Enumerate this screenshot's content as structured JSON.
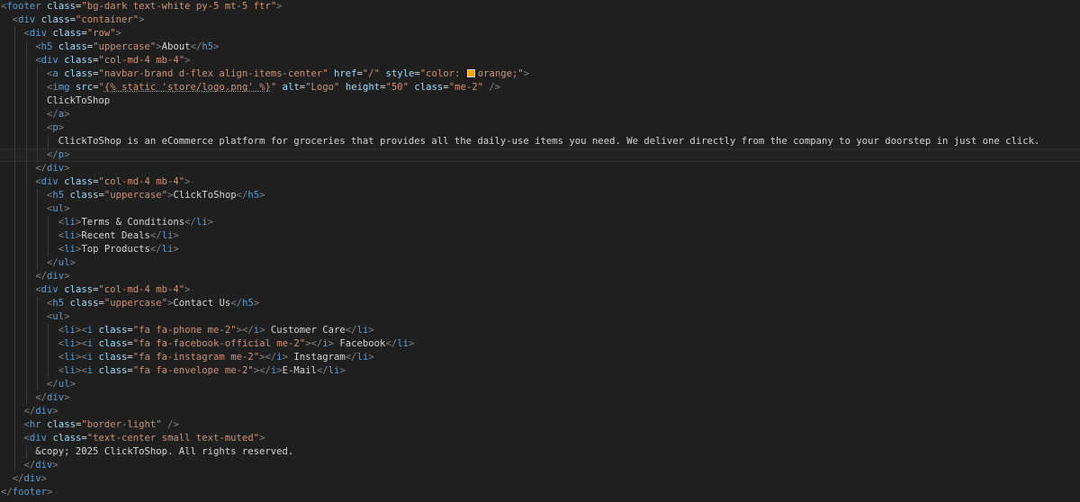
{
  "editor": {
    "language": "html",
    "theme_colors": {
      "background": "#1f1f1f",
      "bracket": "#808080",
      "tag": "#569cd6",
      "attribute": "#9cdcfe",
      "string": "#ce9178",
      "text": "#d4d4d4",
      "swatch": "#ffa500"
    },
    "lines": [
      {
        "indent": 0,
        "tokens": [
          [
            "br",
            "<"
          ],
          [
            "tag",
            "footer"
          ],
          [
            "sp",
            " "
          ],
          [
            "attr",
            "class"
          ],
          [
            "eq",
            "="
          ],
          [
            "str",
            "\"bg-dark text-white py-5 mt-5 ftr\""
          ],
          [
            "br",
            ">"
          ]
        ]
      },
      {
        "indent": 1,
        "tokens": [
          [
            "br",
            "<"
          ],
          [
            "tag",
            "div"
          ],
          [
            "sp",
            " "
          ],
          [
            "attr",
            "class"
          ],
          [
            "eq",
            "="
          ],
          [
            "str",
            "\"container\""
          ],
          [
            "br",
            ">"
          ]
        ]
      },
      {
        "indent": 2,
        "tokens": [
          [
            "br",
            "<"
          ],
          [
            "tag",
            "div"
          ],
          [
            "sp",
            " "
          ],
          [
            "attr",
            "class"
          ],
          [
            "eq",
            "="
          ],
          [
            "str",
            "\"row\""
          ],
          [
            "br",
            ">"
          ]
        ]
      },
      {
        "indent": 3,
        "tokens": [
          [
            "br",
            "<"
          ],
          [
            "tag",
            "h5"
          ],
          [
            "sp",
            " "
          ],
          [
            "attr",
            "class"
          ],
          [
            "eq",
            "="
          ],
          [
            "str",
            "\"uppercase\""
          ],
          [
            "br",
            ">"
          ],
          [
            "txt",
            "About"
          ],
          [
            "br",
            "</"
          ],
          [
            "tag",
            "h5"
          ],
          [
            "br",
            ">"
          ]
        ]
      },
      {
        "indent": 3,
        "tokens": [
          [
            "br",
            "<"
          ],
          [
            "tag",
            "div"
          ],
          [
            "sp",
            " "
          ],
          [
            "attr",
            "class"
          ],
          [
            "eq",
            "="
          ],
          [
            "str",
            "\"col-md-4 mb-4\""
          ],
          [
            "br",
            ">"
          ]
        ]
      },
      {
        "indent": 4,
        "tokens": [
          [
            "br",
            "<"
          ],
          [
            "tag",
            "a"
          ],
          [
            "sp",
            " "
          ],
          [
            "attr",
            "class"
          ],
          [
            "eq",
            "="
          ],
          [
            "str",
            "\"navbar-brand d-flex align-items-center\""
          ],
          [
            "sp",
            " "
          ],
          [
            "attr",
            "href"
          ],
          [
            "eq",
            "="
          ],
          [
            "str",
            "\"/\""
          ],
          [
            "sp",
            " "
          ],
          [
            "attr",
            "style"
          ],
          [
            "eq",
            "="
          ],
          [
            "str",
            "\"color: "
          ],
          [
            "swatch",
            ""
          ],
          [
            "str",
            "orange;\""
          ],
          [
            "br",
            ">"
          ]
        ]
      },
      {
        "indent": 4,
        "tokens": [
          [
            "br",
            "<"
          ],
          [
            "tag",
            "img"
          ],
          [
            "sp",
            " "
          ],
          [
            "attr",
            "src"
          ],
          [
            "eq",
            "="
          ],
          [
            "str",
            "\""
          ],
          [
            "tpl",
            "{% static 'store/logo.png' %}"
          ],
          [
            "str",
            "\""
          ],
          [
            "sp",
            " "
          ],
          [
            "attr",
            "alt"
          ],
          [
            "eq",
            "="
          ],
          [
            "str",
            "\"Logo\""
          ],
          [
            "sp",
            " "
          ],
          [
            "attr",
            "height"
          ],
          [
            "eq",
            "="
          ],
          [
            "str",
            "\"50\""
          ],
          [
            "sp",
            " "
          ],
          [
            "attr",
            "class"
          ],
          [
            "eq",
            "="
          ],
          [
            "str",
            "\"me-2\""
          ],
          [
            "sp",
            " "
          ],
          [
            "br",
            "/>"
          ]
        ]
      },
      {
        "indent": 4,
        "tokens": [
          [
            "txt",
            "ClickToShop"
          ]
        ]
      },
      {
        "indent": 4,
        "tokens": [
          [
            "br",
            "</"
          ],
          [
            "tag",
            "a"
          ],
          [
            "br",
            ">"
          ]
        ]
      },
      {
        "indent": 4,
        "tokens": [
          [
            "br",
            "<"
          ],
          [
            "tag",
            "p"
          ],
          [
            "br",
            ">"
          ]
        ]
      },
      {
        "indent": 5,
        "tokens": [
          [
            "txt",
            "ClickToShop is an eCommerce platform for groceries that provides all the daily-use items you need. We deliver directly from the company to your doorstep in just one click."
          ]
        ]
      },
      {
        "indent": 4,
        "tokens": [
          [
            "br",
            "</"
          ],
          [
            "tag",
            "p"
          ],
          [
            "br",
            ">"
          ]
        ]
      },
      {
        "indent": 3,
        "tokens": [
          [
            "br",
            "</"
          ],
          [
            "tag",
            "div"
          ],
          [
            "br",
            ">"
          ]
        ]
      },
      {
        "indent": 3,
        "tokens": [
          [
            "br",
            "<"
          ],
          [
            "tag",
            "div"
          ],
          [
            "sp",
            " "
          ],
          [
            "attr",
            "class"
          ],
          [
            "eq",
            "="
          ],
          [
            "str",
            "\"col-md-4 mb-4\""
          ],
          [
            "br",
            ">"
          ]
        ]
      },
      {
        "indent": 4,
        "tokens": [
          [
            "br",
            "<"
          ],
          [
            "tag",
            "h5"
          ],
          [
            "sp",
            " "
          ],
          [
            "attr",
            "class"
          ],
          [
            "eq",
            "="
          ],
          [
            "str",
            "\"uppercase\""
          ],
          [
            "br",
            ">"
          ],
          [
            "txt",
            "ClickToShop"
          ],
          [
            "br",
            "</"
          ],
          [
            "tag",
            "h5"
          ],
          [
            "br",
            ">"
          ]
        ]
      },
      {
        "indent": 4,
        "tokens": [
          [
            "br",
            "<"
          ],
          [
            "tag",
            "ul"
          ],
          [
            "br",
            ">"
          ]
        ]
      },
      {
        "indent": 5,
        "tokens": [
          [
            "br",
            "<"
          ],
          [
            "tag",
            "li"
          ],
          [
            "br",
            ">"
          ],
          [
            "txt",
            "Terms & Conditions"
          ],
          [
            "br",
            "</"
          ],
          [
            "tag",
            "li"
          ],
          [
            "br",
            ">"
          ]
        ]
      },
      {
        "indent": 5,
        "tokens": [
          [
            "br",
            "<"
          ],
          [
            "tag",
            "li"
          ],
          [
            "br",
            ">"
          ],
          [
            "txt",
            "Recent Deals"
          ],
          [
            "br",
            "</"
          ],
          [
            "tag",
            "li"
          ],
          [
            "br",
            ">"
          ]
        ]
      },
      {
        "indent": 5,
        "tokens": [
          [
            "br",
            "<"
          ],
          [
            "tag",
            "li"
          ],
          [
            "br",
            ">"
          ],
          [
            "txt",
            "Top Products"
          ],
          [
            "br",
            "</"
          ],
          [
            "tag",
            "li"
          ],
          [
            "br",
            ">"
          ]
        ]
      },
      {
        "indent": 4,
        "tokens": [
          [
            "br",
            "</"
          ],
          [
            "tag",
            "ul"
          ],
          [
            "br",
            ">"
          ]
        ]
      },
      {
        "indent": 3,
        "tokens": [
          [
            "br",
            "</"
          ],
          [
            "tag",
            "div"
          ],
          [
            "br",
            ">"
          ]
        ]
      },
      {
        "indent": 3,
        "tokens": [
          [
            "br",
            "<"
          ],
          [
            "tag",
            "div"
          ],
          [
            "sp",
            " "
          ],
          [
            "attr",
            "class"
          ],
          [
            "eq",
            "="
          ],
          [
            "str",
            "\"col-md-4 mb-4\""
          ],
          [
            "br",
            ">"
          ]
        ]
      },
      {
        "indent": 4,
        "tokens": [
          [
            "br",
            "<"
          ],
          [
            "tag",
            "h5"
          ],
          [
            "sp",
            " "
          ],
          [
            "attr",
            "class"
          ],
          [
            "eq",
            "="
          ],
          [
            "str",
            "\"uppercase\""
          ],
          [
            "br",
            ">"
          ],
          [
            "txt",
            "Contact Us"
          ],
          [
            "br",
            "</"
          ],
          [
            "tag",
            "h5"
          ],
          [
            "br",
            ">"
          ]
        ]
      },
      {
        "indent": 4,
        "tokens": [
          [
            "br",
            "<"
          ],
          [
            "tag",
            "ul"
          ],
          [
            "br",
            ">"
          ]
        ]
      },
      {
        "indent": 5,
        "tokens": [
          [
            "br",
            "<"
          ],
          [
            "tag",
            "li"
          ],
          [
            "br",
            "><"
          ],
          [
            "tag",
            "i"
          ],
          [
            "sp",
            " "
          ],
          [
            "attr",
            "class"
          ],
          [
            "eq",
            "="
          ],
          [
            "str",
            "\"fa fa-phone me-2\""
          ],
          [
            "br",
            "></"
          ],
          [
            "tag",
            "i"
          ],
          [
            "br",
            ">"
          ],
          [
            "txt",
            " Customer Care"
          ],
          [
            "br",
            "</"
          ],
          [
            "tag",
            "li"
          ],
          [
            "br",
            ">"
          ]
        ]
      },
      {
        "indent": 5,
        "tokens": [
          [
            "br",
            "<"
          ],
          [
            "tag",
            "li"
          ],
          [
            "br",
            "><"
          ],
          [
            "tag",
            "i"
          ],
          [
            "sp",
            " "
          ],
          [
            "attr",
            "class"
          ],
          [
            "eq",
            "="
          ],
          [
            "str",
            "\"fa fa-facebook-official me-2\""
          ],
          [
            "br",
            "></"
          ],
          [
            "tag",
            "i"
          ],
          [
            "br",
            ">"
          ],
          [
            "txt",
            " Facebook"
          ],
          [
            "br",
            "</"
          ],
          [
            "tag",
            "li"
          ],
          [
            "br",
            ">"
          ]
        ]
      },
      {
        "indent": 5,
        "tokens": [
          [
            "br",
            "<"
          ],
          [
            "tag",
            "li"
          ],
          [
            "br",
            "><"
          ],
          [
            "tag",
            "i"
          ],
          [
            "sp",
            " "
          ],
          [
            "attr",
            "class"
          ],
          [
            "eq",
            "="
          ],
          [
            "str",
            "\"fa fa-instagram me-2\""
          ],
          [
            "br",
            "></"
          ],
          [
            "tag",
            "i"
          ],
          [
            "br",
            ">"
          ],
          [
            "txt",
            " Instagram"
          ],
          [
            "br",
            "</"
          ],
          [
            "tag",
            "li"
          ],
          [
            "br",
            ">"
          ]
        ]
      },
      {
        "indent": 5,
        "tokens": [
          [
            "br",
            "<"
          ],
          [
            "tag",
            "li"
          ],
          [
            "br",
            "><"
          ],
          [
            "tag",
            "i"
          ],
          [
            "sp",
            " "
          ],
          [
            "attr",
            "class"
          ],
          [
            "eq",
            "="
          ],
          [
            "str",
            "\"fa fa-envelope me-2\""
          ],
          [
            "br",
            "></"
          ],
          [
            "tag",
            "i"
          ],
          [
            "br",
            ">"
          ],
          [
            "txt",
            "E-Mail"
          ],
          [
            "br",
            "</"
          ],
          [
            "tag",
            "li"
          ],
          [
            "br",
            ">"
          ]
        ]
      },
      {
        "indent": 4,
        "tokens": [
          [
            "br",
            "</"
          ],
          [
            "tag",
            "ul"
          ],
          [
            "br",
            ">"
          ]
        ]
      },
      {
        "indent": 3,
        "tokens": [
          [
            "br",
            "</"
          ],
          [
            "tag",
            "div"
          ],
          [
            "br",
            ">"
          ]
        ]
      },
      {
        "indent": 2,
        "tokens": [
          [
            "br",
            "</"
          ],
          [
            "tag",
            "div"
          ],
          [
            "br",
            ">"
          ]
        ]
      },
      {
        "indent": 2,
        "tokens": [
          [
            "br",
            "<"
          ],
          [
            "tag",
            "hr"
          ],
          [
            "sp",
            " "
          ],
          [
            "attr",
            "class"
          ],
          [
            "eq",
            "="
          ],
          [
            "str",
            "\"border-light\""
          ],
          [
            "sp",
            " "
          ],
          [
            "br",
            "/>"
          ]
        ]
      },
      {
        "indent": 2,
        "tokens": [
          [
            "br",
            "<"
          ],
          [
            "tag",
            "div"
          ],
          [
            "sp",
            " "
          ],
          [
            "attr",
            "class"
          ],
          [
            "eq",
            "="
          ],
          [
            "str",
            "\"text-center small text-muted\""
          ],
          [
            "br",
            ">"
          ]
        ]
      },
      {
        "indent": 3,
        "tokens": [
          [
            "txt",
            "&copy; 2025 ClickToShop. All rights reserved."
          ]
        ]
      },
      {
        "indent": 2,
        "tokens": [
          [
            "br",
            "</"
          ],
          [
            "tag",
            "div"
          ],
          [
            "br",
            ">"
          ]
        ]
      },
      {
        "indent": 1,
        "tokens": [
          [
            "br",
            "</"
          ],
          [
            "tag",
            "div"
          ],
          [
            "br",
            ">"
          ]
        ]
      },
      {
        "indent": 0,
        "tokens": [
          [
            "br",
            "</"
          ],
          [
            "tag",
            "footer"
          ],
          [
            "br",
            ">"
          ]
        ]
      }
    ]
  }
}
